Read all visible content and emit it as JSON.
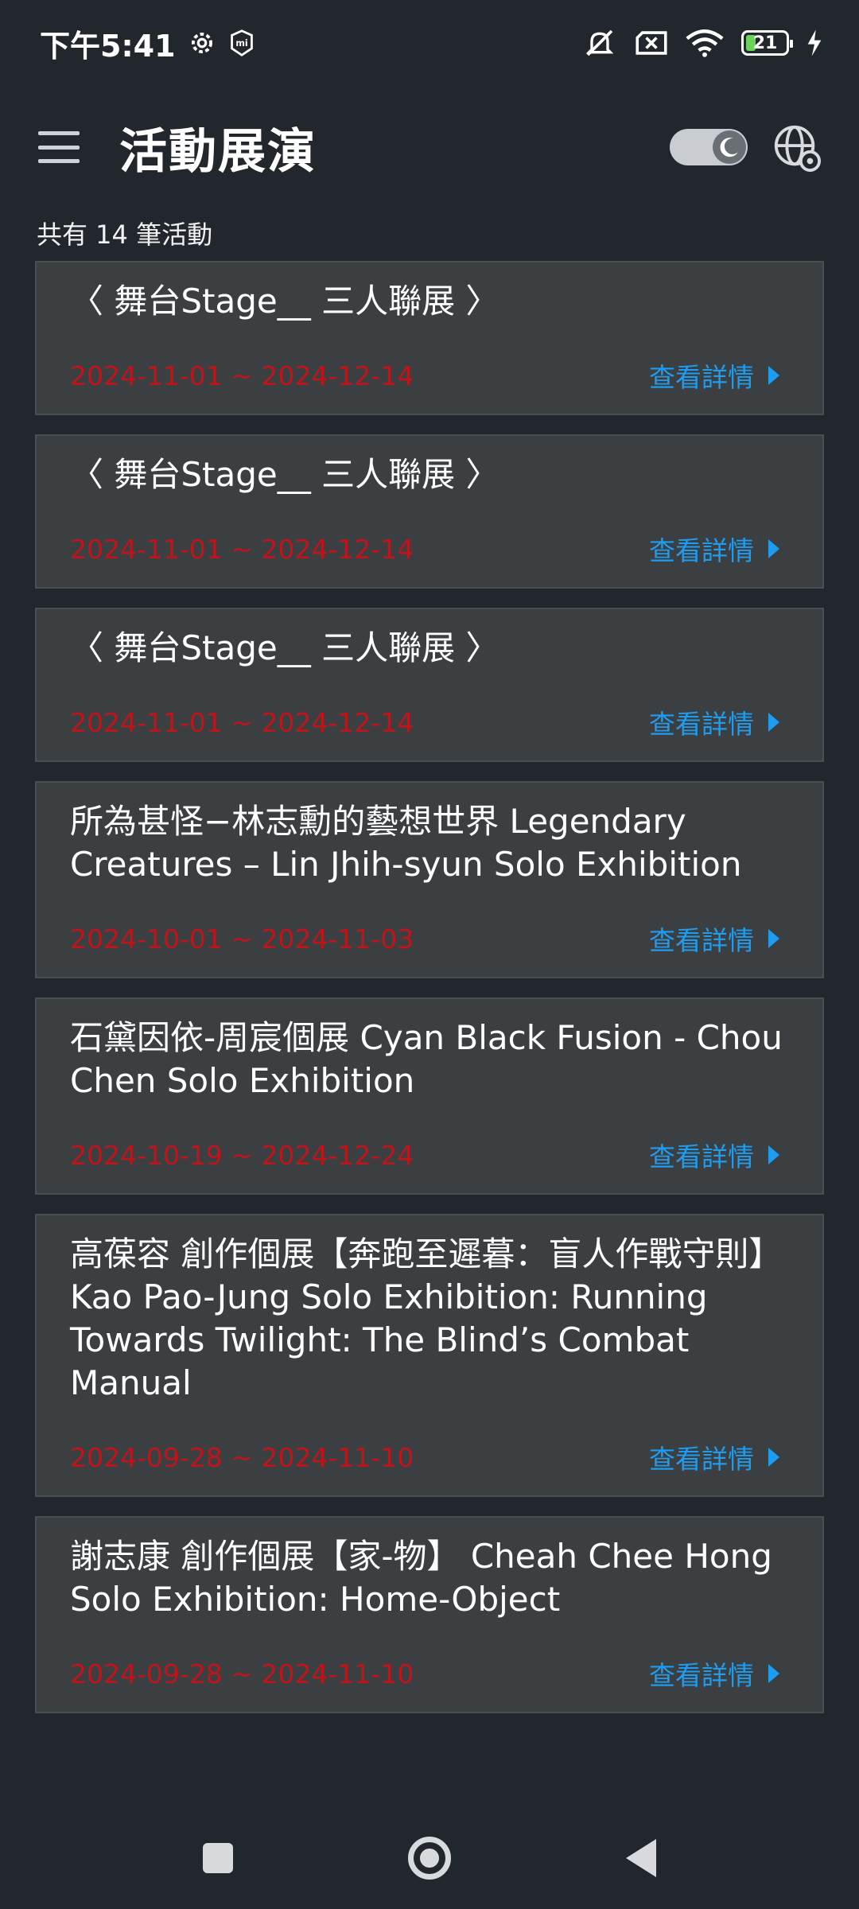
{
  "status": {
    "time": "下午5:41",
    "battery": "21"
  },
  "appbar": {
    "title": "活動展演"
  },
  "summary": {
    "count_text": "共有 14 筆活動"
  },
  "colors": {
    "background": "#22272e",
    "card": "#3c3f42",
    "date": "#c0141b",
    "link": "#1e9cf0"
  },
  "events": [
    {
      "title": "〈 舞台Stage__ 三人聯展 〉",
      "date": "2024-11-01 ~ 2024-12-14",
      "link": "查看詳情"
    },
    {
      "title": "〈 舞台Stage__ 三人聯展 〉",
      "date": "2024-11-01 ~ 2024-12-14",
      "link": "查看詳情"
    },
    {
      "title": "〈 舞台Stage__ 三人聯展 〉",
      "date": "2024-11-01 ~ 2024-12-14",
      "link": "查看詳情"
    },
    {
      "title": "所為甚怪−林志勳的藝想世界 Legendary Creatures – Lin Jhih-syun Solo Exhibition",
      "date": "2024-10-01 ~ 2024-11-03",
      "link": "查看詳情"
    },
    {
      "title": "石黛因依-周宸個展  Cyan Black Fusion - Chou Chen Solo Exhibition",
      "date": "2024-10-19 ~ 2024-12-24",
      "link": "查看詳情"
    },
    {
      "title": "高葆容 創作個展【奔跑至遲暮：盲人作戰守則】 Kao Pao-Jung Solo Exhibition: Running Towards Twilight: The Blind’s Combat Manual",
      "date": "2024-09-28 ~ 2024-11-10",
      "link": "查看詳情"
    },
    {
      "title": "謝志康 創作個展【家-物】 Cheah Chee Hong Solo Exhibition: Home-Object",
      "date": "2024-09-28 ~ 2024-11-10",
      "link": "查看詳情"
    }
  ]
}
